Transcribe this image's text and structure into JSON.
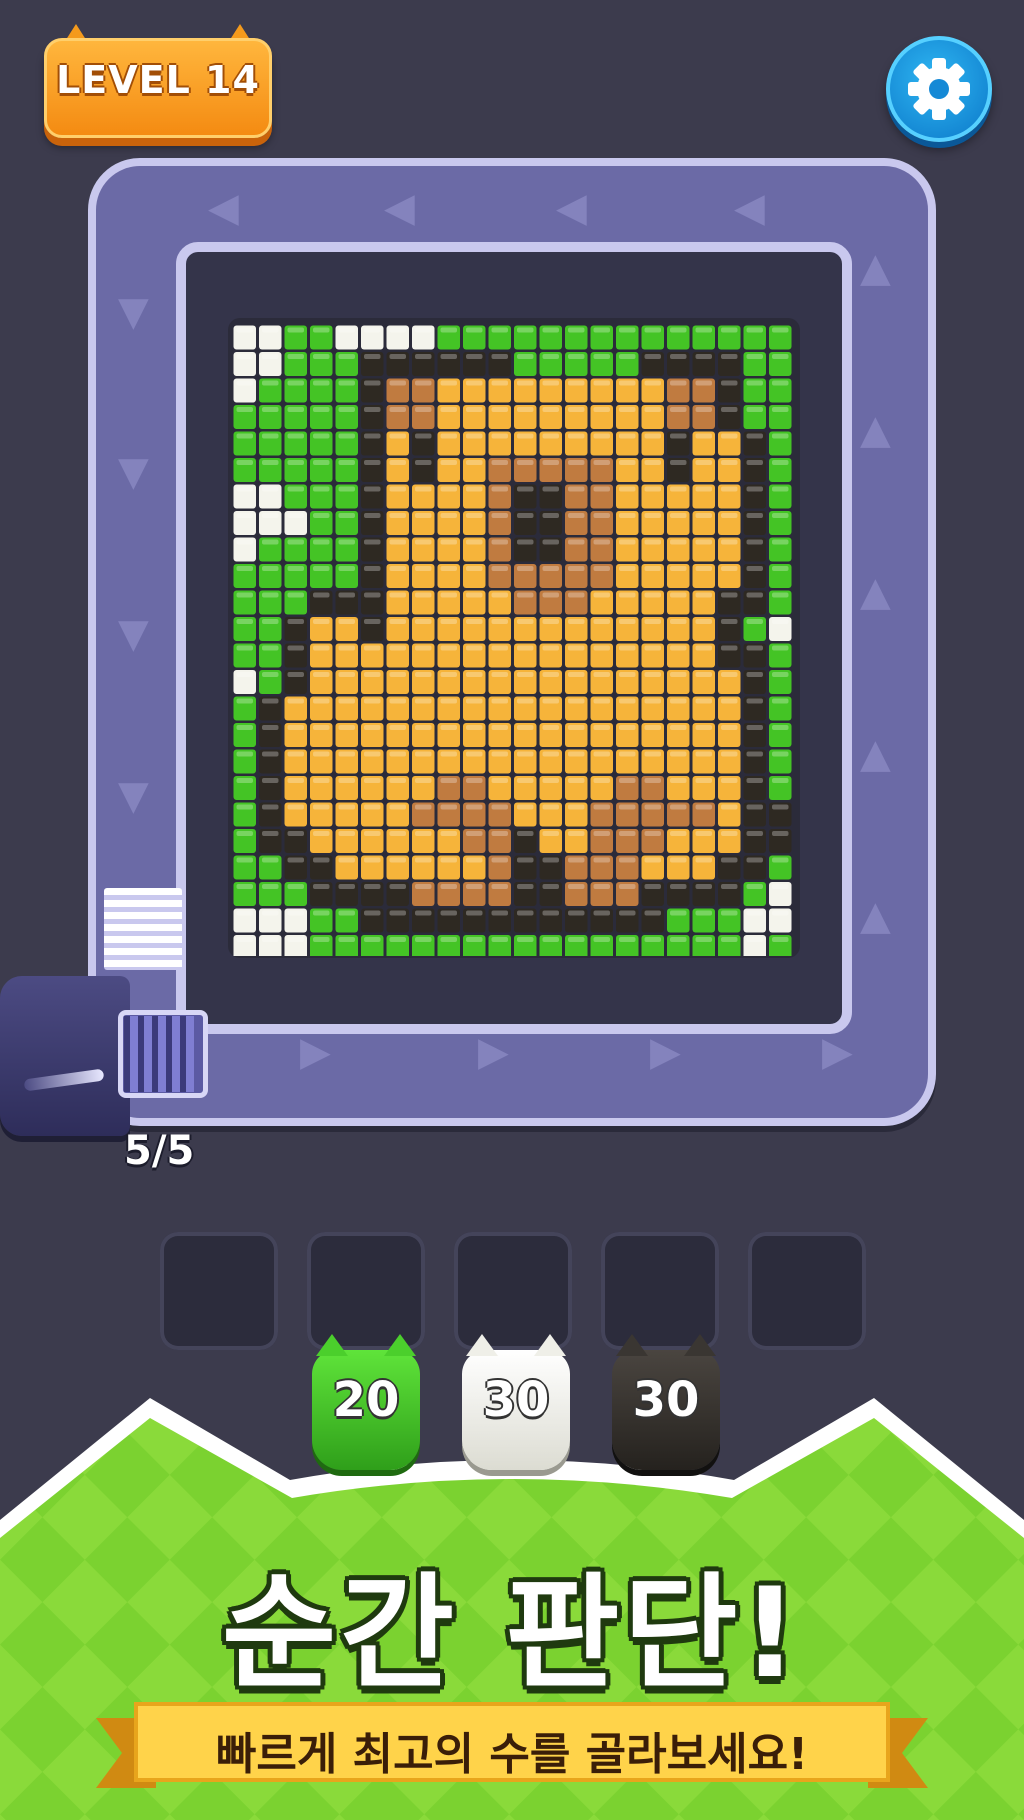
{
  "header": {
    "level_label": "LEVEL 14",
    "settings_icon": "gear-icon"
  },
  "launcher": {
    "ammo_count": "5/5"
  },
  "slots": {
    "count": 5,
    "filled": 0
  },
  "cats": [
    {
      "color": "green",
      "count": "20"
    },
    {
      "color": "white",
      "count": "30"
    },
    {
      "color": "black",
      "count": "30"
    }
  ],
  "banner": {
    "headline": "순간 판단!",
    "subtitle": "빠르게 최고의 수를 골라보세요!"
  },
  "colors": {
    "G": "#44c425",
    "W": "#f4f4ec",
    "K": "#2e2922",
    "O": "#f6b43a",
    "B": "#c07b40"
  },
  "pixel_art": {
    "subject": "capybara",
    "rows": [
      "WWGGWWWWGGGGGGGGGGGGGG",
      "WWGGGKKKKKKGGGGGKKKKGG",
      "WGGGGKBBOOOOOOOOOBBKGG",
      "GGGGGKBBOOOOOOOOOBBKGG",
      "GGGGGKOKOOOOOOOOOKOOKG",
      "GGGGGKOKOOBBBBBOOKOOKG",
      "WWGGGKOOOOBKKBBOOOOOKG",
      "WWWGGKOOOOBKKBBOOOOOKG",
      "WGGGGKOOOOBKKBBOOOOOKG",
      "GGGGGKOOOOBBBBBOOOOOKG",
      "GGGKKKOOOOOBBBOOOOOKKG",
      "GGKOOKOOOOOOOOOOOOOKGW",
      "GGKOOOOOOOOOOOOOOOOKKG",
      "WGKOOOOOOOOOOOOOOOOOKG",
      "GKOOOOOOOOOOOOOOOOOOKG",
      "GKOOOOOOOOOOOOOOOOOOKG",
      "GKOOOOOOOOOOOOOOOOOOKG",
      "GKOOOOOOBBOOOOOBBOOOKG",
      "GKOOOOOBBBBOOOBBBBBOKK",
      "GKKOOOOOOBBKOOBBBOOOKK",
      "GGKKOOOOOOBKKBBBOOOKKG",
      "GGGKKKKBBBBKKBBBKKKKGW",
      "WWWGGKKKKKKKKKKKKGGGWW",
      "WWWGGGGGGGGGGGGGGGGGWG"
    ]
  }
}
